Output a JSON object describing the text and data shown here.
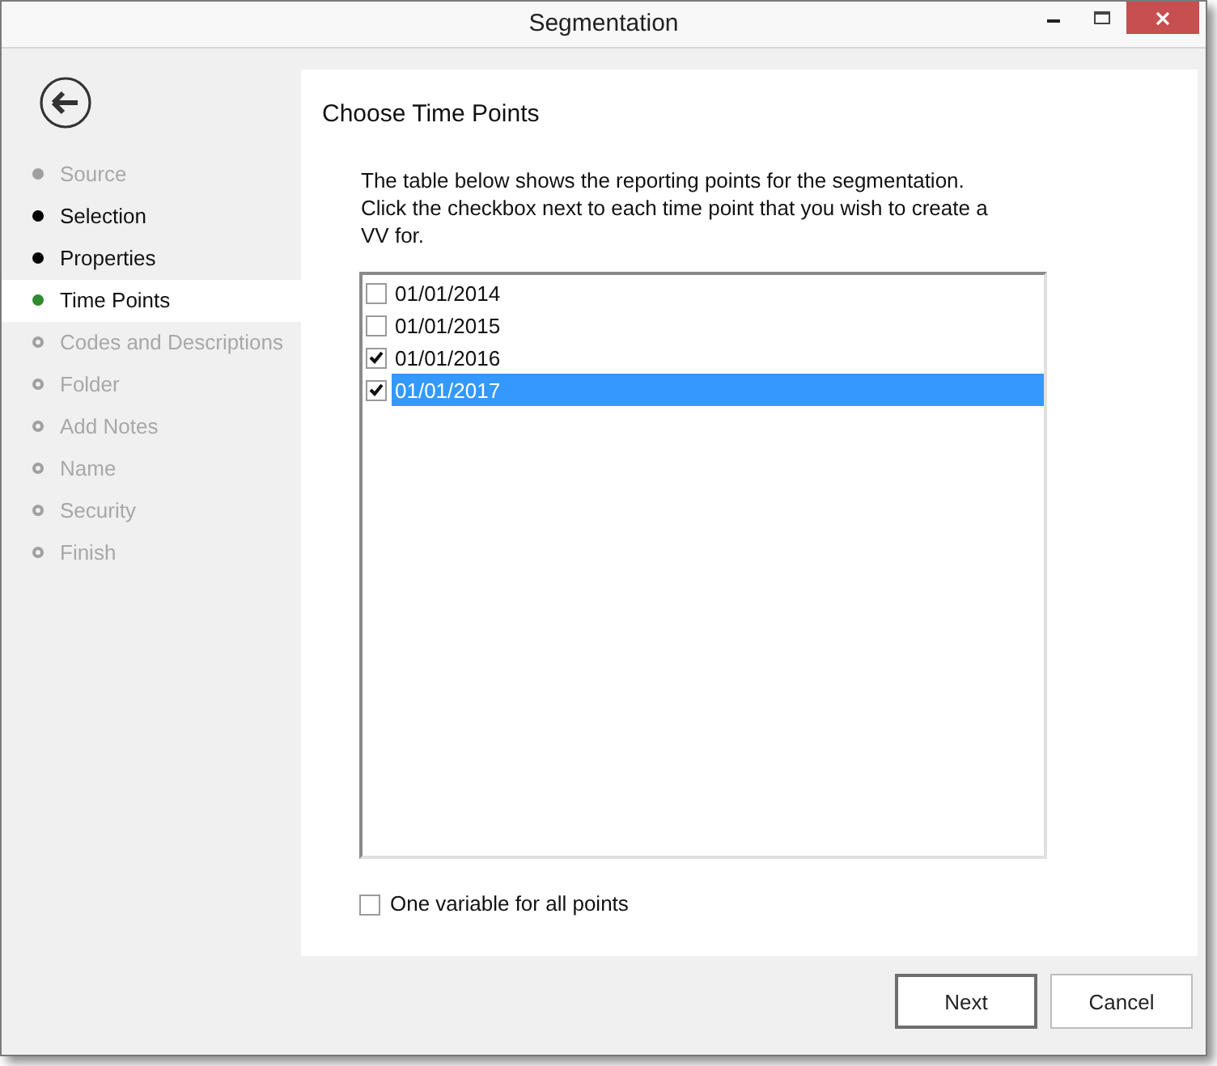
{
  "window": {
    "title": "Segmentation"
  },
  "steps": [
    {
      "label": "Source",
      "kind": "skipped",
      "selected": false
    },
    {
      "label": "Selection",
      "kind": "done",
      "selected": false
    },
    {
      "label": "Properties",
      "kind": "done",
      "selected": false
    },
    {
      "label": "Time Points",
      "kind": "current",
      "selected": true
    },
    {
      "label": "Codes and Descriptions",
      "kind": "pending",
      "selected": false
    },
    {
      "label": "Folder",
      "kind": "pending",
      "selected": false
    },
    {
      "label": "Add Notes",
      "kind": "pending",
      "selected": false
    },
    {
      "label": "Name",
      "kind": "pending",
      "selected": false
    },
    {
      "label": "Security",
      "kind": "pending",
      "selected": false
    },
    {
      "label": "Finish",
      "kind": "pending",
      "selected": false
    }
  ],
  "page": {
    "heading": "Choose Time Points",
    "description": "The table below shows the reporting points for the segmentation. Click the checkbox next to each time point that you wish to create a VV for.",
    "time_points": [
      {
        "label": "01/01/2014",
        "checked": false,
        "selected": false
      },
      {
        "label": "01/01/2015",
        "checked": false,
        "selected": false
      },
      {
        "label": "01/01/2016",
        "checked": true,
        "selected": false
      },
      {
        "label": "01/01/2017",
        "checked": true,
        "selected": true
      }
    ],
    "one_variable": {
      "label": "One variable for all points",
      "checked": false
    }
  },
  "buttons": [
    {
      "label": "Next",
      "default": true
    },
    {
      "label": "Cancel",
      "default": false
    }
  ]
}
